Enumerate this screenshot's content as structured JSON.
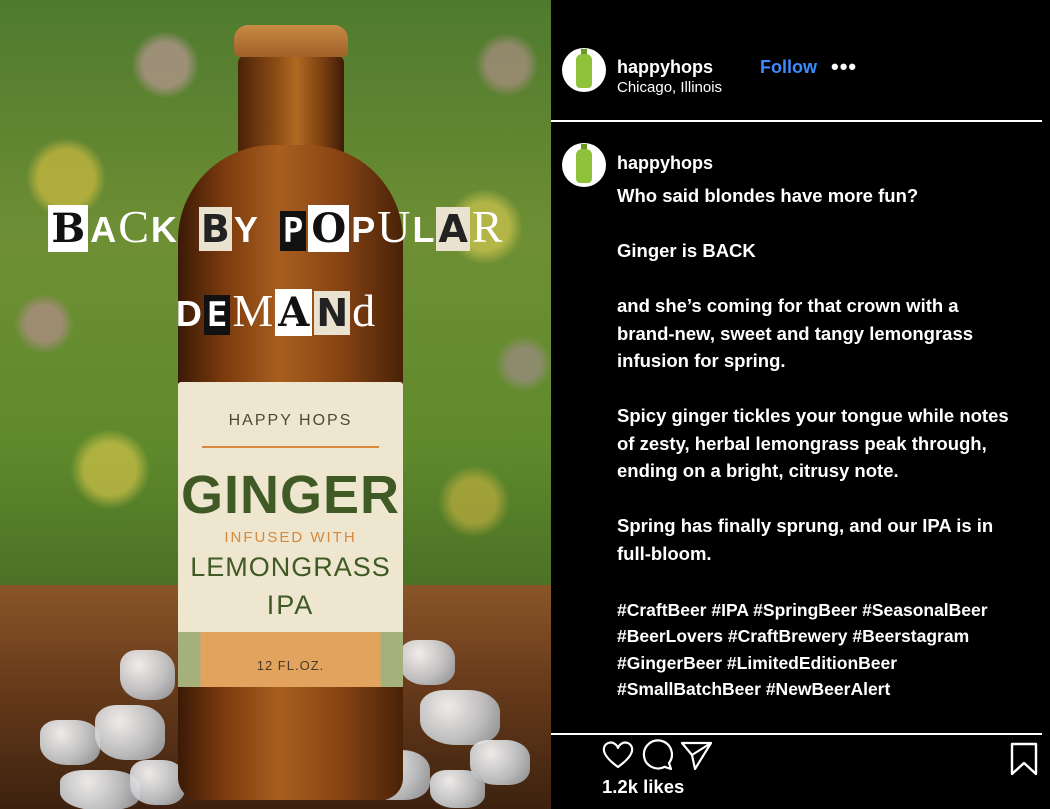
{
  "image": {
    "headline_line1": [
      "B",
      "A",
      "C",
      "K",
      "B",
      "Y",
      "P",
      "O",
      "P",
      "U",
      "L",
      "A",
      "R"
    ],
    "headline_line2": [
      "D",
      "E",
      "M",
      "A",
      "N",
      "d"
    ],
    "label": {
      "brand": "HAPPY HOPS",
      "name": "GINGER",
      "infused": "INFUSED WITH",
      "flavor": "LEMONGRASS",
      "style": "IPA",
      "volume": "12 FL.OZ."
    }
  },
  "header": {
    "username": "happyhops",
    "location": "Chicago, Illinois",
    "follow_label": "Follow",
    "more_label": "•••"
  },
  "caption": {
    "username": "happyhops",
    "paragraphs": [
      "Who said blondes have more fun?",
      "Ginger is BACK",
      "and she’s coming for that crown with a brand-new, sweet and tangy lemongrass infusion for spring.",
      "Spicy ginger tickles your tongue while notes of zesty, herbal lemongrass peak through, ending on a bright, citrusy note.",
      "Spring has finally sprung, and our IPA is in full-bloom."
    ],
    "hashtags": "#CraftBeer #IPA #SpringBeer #SeasonalBeer #BeerLovers #CraftBrewery #Beerstagram #GingerBeer #LimitedEditionBeer #SmallBatchBeer #NewBeerAlert"
  },
  "footer": {
    "likes": "1.2k likes",
    "icons": [
      "heart-icon",
      "comment-icon",
      "send-icon",
      "bookmark-icon"
    ]
  },
  "colors": {
    "follow": "#3d8bff",
    "background": "#000000",
    "text": "#ffffff"
  }
}
